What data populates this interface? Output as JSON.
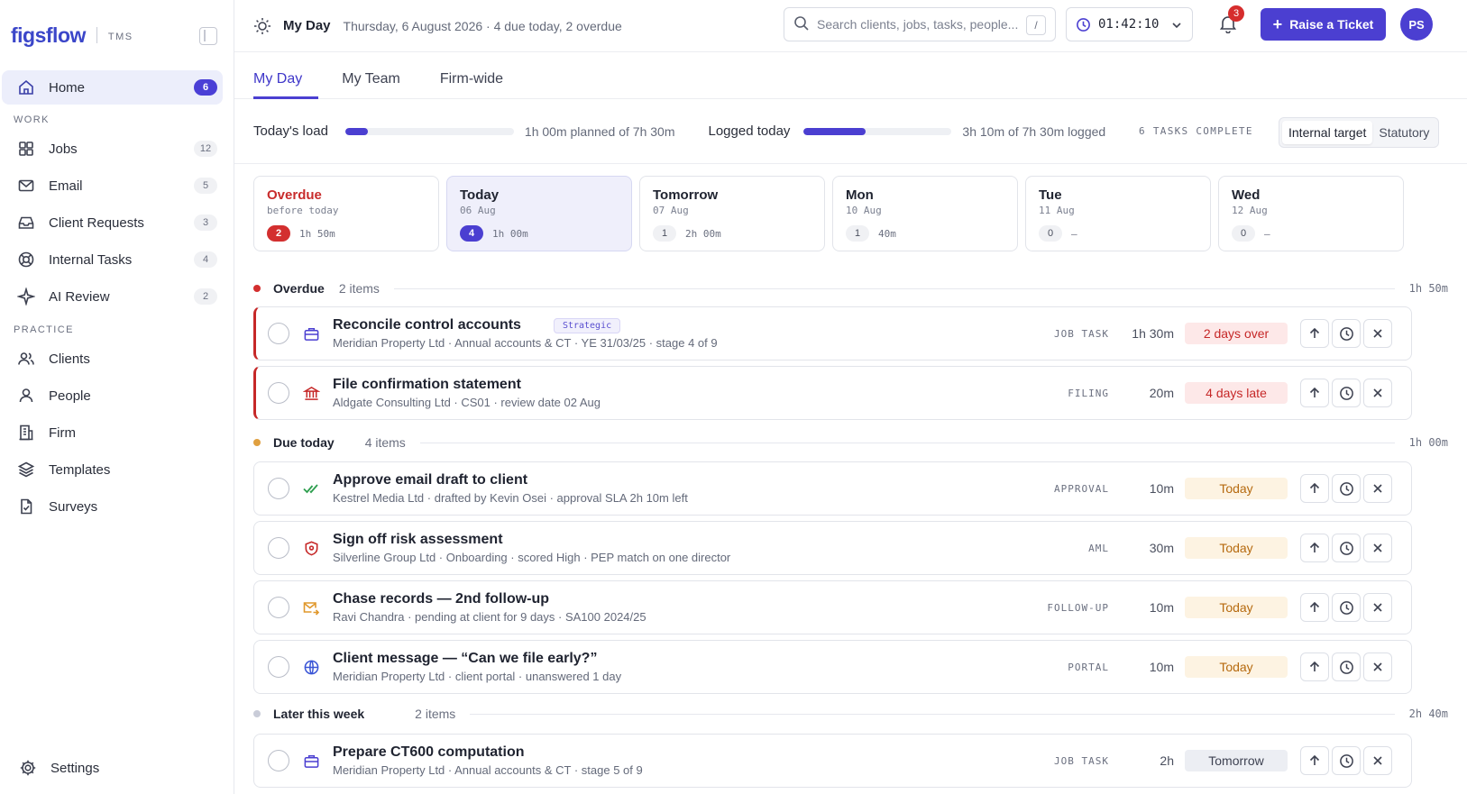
{
  "brand": {
    "logo": "figsflow",
    "product": "TMS"
  },
  "sidebar": {
    "home": {
      "label": "Home",
      "count": "6"
    },
    "work_heading": "WORK",
    "work": [
      {
        "label": "Jobs",
        "count": "12",
        "icon": "grid-icon"
      },
      {
        "label": "Email",
        "count": "5",
        "icon": "mail-icon"
      },
      {
        "label": "Client Requests",
        "count": "3",
        "icon": "inbox-icon"
      },
      {
        "label": "Internal Tasks",
        "count": "4",
        "icon": "lifebuoy-icon"
      },
      {
        "label": "AI Review",
        "count": "2",
        "icon": "sparkle-icon"
      }
    ],
    "practice_heading": "PRACTICE",
    "practice": [
      {
        "label": "Clients",
        "icon": "users-icon"
      },
      {
        "label": "People",
        "icon": "user-icon"
      },
      {
        "label": "Firm",
        "icon": "building-icon"
      },
      {
        "label": "Templates",
        "icon": "layers-icon"
      },
      {
        "label": "Surveys",
        "icon": "survey-icon"
      }
    ],
    "settings": "Settings"
  },
  "topbar": {
    "title": "My Day",
    "subtitle": "Thursday, 6 August 2026 · 4 due today, 2 overdue",
    "search_placeholder": "Search clients, jobs, tasks, people...",
    "search_shortcut": "/",
    "timer": "01:42:10",
    "notifications": "3",
    "raise_label": "Raise a Ticket",
    "avatar": "PS",
    "accent": "#4B3FD1"
  },
  "tabs": [
    "My Day",
    "My Team",
    "Firm-wide"
  ],
  "load": {
    "today_label": "Today's load",
    "today_text": "1h 00m planned of 7h 30m",
    "today_fraction": 0.133,
    "logged_label": "Logged today",
    "logged_text": "3h 10m of 7h 30m logged",
    "logged_fraction": 0.42,
    "tasks_complete": "6 TASKS COMPLETE",
    "toggle": [
      "Internal target",
      "Statutory"
    ]
  },
  "days": [
    {
      "name": "Overdue",
      "sub": "before today",
      "count": "2",
      "time": "1h 50m",
      "style": "red"
    },
    {
      "name": "Today",
      "sub": "06 Aug",
      "count": "4",
      "time": "1h 00m",
      "style": "blue"
    },
    {
      "name": "Tomorrow",
      "sub": "07 Aug",
      "count": "1",
      "time": "2h 00m",
      "style": "grey"
    },
    {
      "name": "Mon",
      "sub": "10 Aug",
      "count": "1",
      "time": "40m",
      "style": "grey"
    },
    {
      "name": "Tue",
      "sub": "11 Aug",
      "count": "0",
      "time": "—",
      "style": "grey"
    },
    {
      "name": "Wed",
      "sub": "12 Aug",
      "count": "0",
      "time": "—",
      "style": "grey"
    }
  ],
  "sections": [
    {
      "name": "Overdue",
      "count": "2 items",
      "time": "1h 50m",
      "color": "#D32F2F"
    },
    {
      "name": "Due today",
      "count": "4 items",
      "time": "1h 00m",
      "color": "#E0A040"
    },
    {
      "name": "Later this week",
      "count": "2 items",
      "time": "2h 40m",
      "color": "#C9CCD8"
    }
  ],
  "tasks": [
    {
      "title": "Reconcile control accounts",
      "tag": "Strategic",
      "sub": "Meridian Property Ltd · Annual accounts & CT · YE 31/03/25 · stage 4 of 9",
      "type": "JOB TASK",
      "duration": "1h 30m",
      "status": "2 days over",
      "status_style": "red",
      "icon": "briefcase-icon"
    },
    {
      "title": "File confirmation statement",
      "tag": "",
      "sub": "Aldgate Consulting Ltd · CS01 · review date 02 Aug",
      "type": "FILING",
      "duration": "20m",
      "status": "4 days late",
      "status_style": "red",
      "icon": "bank-icon"
    },
    {
      "title": "Approve email draft to client",
      "tag": "",
      "sub": "Kestrel Media Ltd · drafted by Kevin Osei · approval SLA 2h 10m left",
      "type": "APPROVAL",
      "duration": "10m",
      "status": "Today",
      "status_style": "amber",
      "icon": "double-check-icon"
    },
    {
      "title": "Sign off risk assessment",
      "tag": "",
      "sub": "Silverline Group Ltd · Onboarding · scored High · PEP match on one director",
      "type": "AML",
      "duration": "30m",
      "status": "Today",
      "status_style": "amber",
      "icon": "shield-icon"
    },
    {
      "title": "Chase records — 2nd follow-up",
      "tag": "",
      "sub": "Ravi Chandra · pending at client for 9 days · SA100 2024/25",
      "type": "FOLLOW-UP",
      "duration": "10m",
      "status": "Today",
      "status_style": "amber",
      "icon": "mail-forward-icon"
    },
    {
      "title": "Client message — “Can we file early?”",
      "tag": "",
      "sub": "Meridian Property Ltd · client portal · unanswered 1 day",
      "type": "PORTAL",
      "duration": "10m",
      "status": "Today",
      "status_style": "amber",
      "icon": "globe-icon"
    },
    {
      "title": "Prepare CT600 computation",
      "tag": "",
      "sub": "Meridian Property Ltd · Annual accounts & CT · stage 5 of 9",
      "type": "JOB TASK",
      "duration": "2h",
      "status": "Tomorrow",
      "status_style": "grey",
      "icon": "briefcase-icon"
    }
  ]
}
